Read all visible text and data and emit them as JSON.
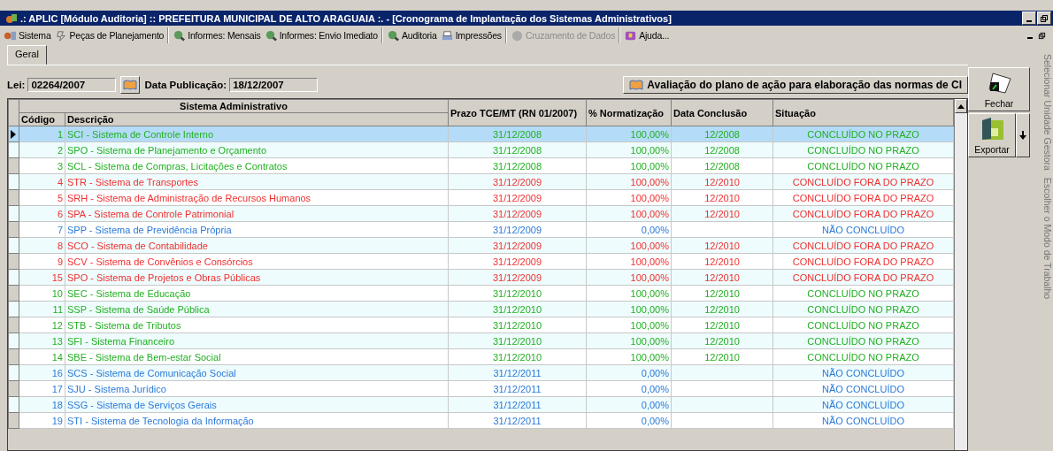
{
  "window": {
    "title": ".: APLIC [Módulo Auditoria] :: PREFEITURA MUNICIPAL DE ALTO ARAGUAIA :. - [Cronograma de Implantação dos Sistemas Administrativos]"
  },
  "menu": [
    {
      "label": "Sistema",
      "disabled": false
    },
    {
      "label": "Peças de Planejamento",
      "disabled": false
    },
    {
      "label": "Informes: Mensais",
      "disabled": false
    },
    {
      "label": "Informes: Envio Imediato",
      "disabled": false
    },
    {
      "label": "Auditoria",
      "disabled": false
    },
    {
      "label": "Impressões",
      "disabled": false
    },
    {
      "label": "Cruzamento de Dados",
      "disabled": true
    },
    {
      "label": "Ajuda...",
      "disabled": false
    }
  ],
  "tabs": [
    {
      "label": "Geral",
      "selected": true
    }
  ],
  "lei": {
    "label": "Lei:",
    "value": "02264/2007"
  },
  "publicacao": {
    "label": "Data Publicação:",
    "value": "18/12/2007"
  },
  "evaluation_button": "Avaliação do plano de ação para elaboração das normas de CI",
  "table": {
    "group_header": "Sistema Administrativo",
    "columns": [
      "Código",
      "Descrição",
      "Prazo TCE/MT (RN 01/2007)",
      "% Normatização",
      "Data Conclusão",
      "Situação"
    ],
    "rows": [
      {
        "code": "1",
        "description": "SCI - Sistema de Controle Interno",
        "deadline": "31/12/2008",
        "percent": "100,00%",
        "conclusion": "12/2008",
        "status": "CONCLUÍDO NO PRAZO",
        "color": "#22b022",
        "selected": true
      },
      {
        "code": "2",
        "description": "SPO - Sistema de Planejamento e Orçamento",
        "deadline": "31/12/2008",
        "percent": "100,00%",
        "conclusion": "12/2008",
        "status": "CONCLUÍDO NO PRAZO",
        "color": "#22b022",
        "selected": false
      },
      {
        "code": "3",
        "description": "SCL - Sistema de Compras, Licitações e Contratos",
        "deadline": "31/12/2008",
        "percent": "100,00%",
        "conclusion": "12/2008",
        "status": "CONCLUÍDO NO PRAZO",
        "color": "#22b022",
        "selected": false
      },
      {
        "code": "4",
        "description": "STR - Sistema de Transportes",
        "deadline": "31/12/2009",
        "percent": "100,00%",
        "conclusion": "12/2010",
        "status": "CONCLUÍDO FORA DO PRAZO",
        "color": "#f03030",
        "selected": false
      },
      {
        "code": "5",
        "description": "SRH - Sistema de Administração de Recursos Humanos",
        "deadline": "31/12/2009",
        "percent": "100,00%",
        "conclusion": "12/2010",
        "status": "CONCLUÍDO FORA DO PRAZO",
        "color": "#f03030",
        "selected": false
      },
      {
        "code": "6",
        "description": "SPA - Sistema de Controle Patrimonial",
        "deadline": "31/12/2009",
        "percent": "100,00%",
        "conclusion": "12/2010",
        "status": "CONCLUÍDO FORA DO PRAZO",
        "color": "#f03030",
        "selected": false
      },
      {
        "code": "7",
        "description": "SPP - Sistema de Previdência Própria",
        "deadline": "31/12/2009",
        "percent": "0,00%",
        "conclusion": "",
        "status": "NÃO CONCLUÍDO",
        "color": "#2a7ad8",
        "selected": false
      },
      {
        "code": "8",
        "description": "SCO - Sistema de Contabilidade",
        "deadline": "31/12/2009",
        "percent": "100,00%",
        "conclusion": "12/2010",
        "status": "CONCLUÍDO FORA DO PRAZO",
        "color": "#f03030",
        "selected": false
      },
      {
        "code": "9",
        "description": "SCV - Sistema de Convênios e Consórcios",
        "deadline": "31/12/2009",
        "percent": "100,00%",
        "conclusion": "12/2010",
        "status": "CONCLUÍDO FORA DO PRAZO",
        "color": "#f03030",
        "selected": false
      },
      {
        "code": "15",
        "description": "SPO - Sistema de Projetos e Obras Públicas",
        "deadline": "31/12/2009",
        "percent": "100,00%",
        "conclusion": "12/2010",
        "status": "CONCLUÍDO FORA DO PRAZO",
        "color": "#f03030",
        "selected": false
      },
      {
        "code": "10",
        "description": "SEC - Sistema de Educação",
        "deadline": "31/12/2010",
        "percent": "100,00%",
        "conclusion": "12/2010",
        "status": "CONCLUÍDO NO PRAZO",
        "color": "#22b022",
        "selected": false
      },
      {
        "code": "11",
        "description": "SSP - Sistema de Saúde Pública",
        "deadline": "31/12/2010",
        "percent": "100,00%",
        "conclusion": "12/2010",
        "status": "CONCLUÍDO NO PRAZO",
        "color": "#22b022",
        "selected": false
      },
      {
        "code": "12",
        "description": "STB - Sistema de Tributos",
        "deadline": "31/12/2010",
        "percent": "100,00%",
        "conclusion": "12/2010",
        "status": "CONCLUÍDO NO PRAZO",
        "color": "#22b022",
        "selected": false
      },
      {
        "code": "13",
        "description": "SFI - Sistema Financeiro",
        "deadline": "31/12/2010",
        "percent": "100,00%",
        "conclusion": "12/2010",
        "status": "CONCLUÍDO NO PRAZO",
        "color": "#22b022",
        "selected": false
      },
      {
        "code": "14",
        "description": "SBE - Sistema de Bem-estar Social",
        "deadline": "31/12/2010",
        "percent": "100,00%",
        "conclusion": "12/2010",
        "status": "CONCLUÍDO NO PRAZO",
        "color": "#22b022",
        "selected": false
      },
      {
        "code": "16",
        "description": "SCS - Sistema de Comunicação Social",
        "deadline": "31/12/2011",
        "percent": "0,00%",
        "conclusion": "",
        "status": "NÃO CONCLUÍDO",
        "color": "#2a7ad8",
        "selected": false
      },
      {
        "code": "17",
        "description": "SJU - Sistema Jurídico",
        "deadline": "31/12/2011",
        "percent": "0,00%",
        "conclusion": "",
        "status": "NÃO CONCLUÍDO",
        "color": "#2a7ad8",
        "selected": false
      },
      {
        "code": "18",
        "description": "SSG - Sistema de Serviços Gerais",
        "deadline": "31/12/2011",
        "percent": "0,00%",
        "conclusion": "",
        "status": "NÃO CONCLUÍDO",
        "color": "#2a7ad8",
        "selected": false
      },
      {
        "code": "19",
        "description": "STI - Sistema de Tecnologia da Informação",
        "deadline": "31/12/2011",
        "percent": "0,00%",
        "conclusion": "",
        "status": "NÃO CONCLUÍDO",
        "color": "#2a7ad8",
        "selected": false
      }
    ]
  },
  "side_buttons": [
    {
      "label": "Fechar",
      "kind": "close"
    },
    {
      "label": "Exportar",
      "kind": "export"
    }
  ],
  "side_panel": [
    "Selecionar Unidade Gestora",
    "Escolher o Modo de Trabalho"
  ]
}
